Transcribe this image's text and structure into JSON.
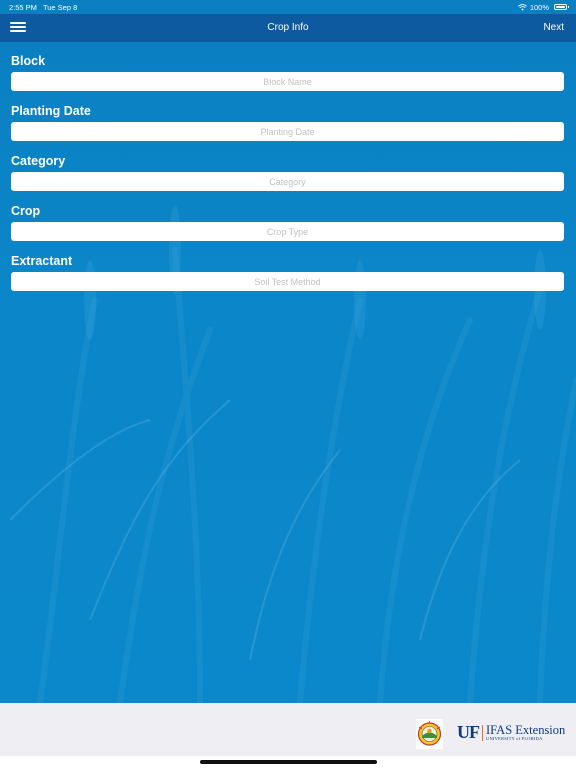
{
  "status": {
    "time": "2:55 PM",
    "date": "Tue Sep 8",
    "battery": "100%"
  },
  "nav": {
    "title": "Crop Info",
    "next_label": "Next"
  },
  "fields": [
    {
      "label": "Block",
      "placeholder": "Block Name"
    },
    {
      "label": "Planting Date",
      "placeholder": "Planting Date"
    },
    {
      "label": "Category",
      "placeholder": "Category"
    },
    {
      "label": "Crop",
      "placeholder": "Crop Type"
    },
    {
      "label": "Extractant",
      "placeholder": "Soil Test Method"
    }
  ],
  "footer": {
    "uf_mark": "UF",
    "extension_name": "IFAS Extension",
    "university": "UNIVERSITY of FLORIDA"
  },
  "colors": {
    "navbar": "#0d5aa0",
    "background": "#0b86c8",
    "footer": "#efeff3"
  }
}
